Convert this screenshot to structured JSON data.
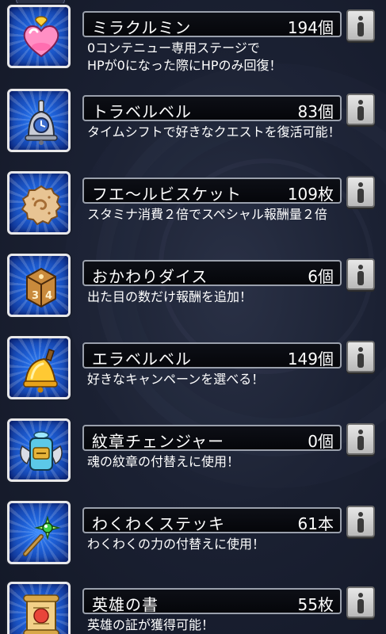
{
  "items": [
    {
      "name": "ミラクルミン",
      "count": "194個",
      "description": [
        "0コンテニュー専用ステージで",
        "HPが0になった際にHPのみ回復！"
      ],
      "icon": "heart-potion-icon"
    },
    {
      "name": "トラベルベル",
      "count": "83個",
      "description": [
        "タイムシフトで好きなクエストを復活可能！"
      ],
      "icon": "travel-bell-icon"
    },
    {
      "name": "フエ〜ルビスケット",
      "count": "109枚",
      "description": [
        "スタミナ消費２倍でスペシャル報酬量２倍"
      ],
      "icon": "biscuit-icon"
    },
    {
      "name": "おかわりダイス",
      "count": "6個",
      "description": [
        "出た目の数だけ報酬を追加！"
      ],
      "icon": "dice-icon"
    },
    {
      "name": "エラベルベル",
      "count": "149個",
      "description": [
        "好きなキャンペーンを選べる！"
      ],
      "icon": "gold-bell-icon"
    },
    {
      "name": "紋章チェンジャー",
      "count": "0個",
      "description": [
        "魂の紋章の付替えに使用！"
      ],
      "icon": "emblem-changer-icon"
    },
    {
      "name": "わくわくステッキ",
      "count": "61本",
      "description": [
        "わくわくの力の付替えに使用！"
      ],
      "icon": "magic-wand-icon"
    },
    {
      "name": "英雄の書",
      "count": "55枚",
      "description": [
        "英雄の証が獲得可能！"
      ],
      "icon": "hero-scroll-icon"
    }
  ]
}
